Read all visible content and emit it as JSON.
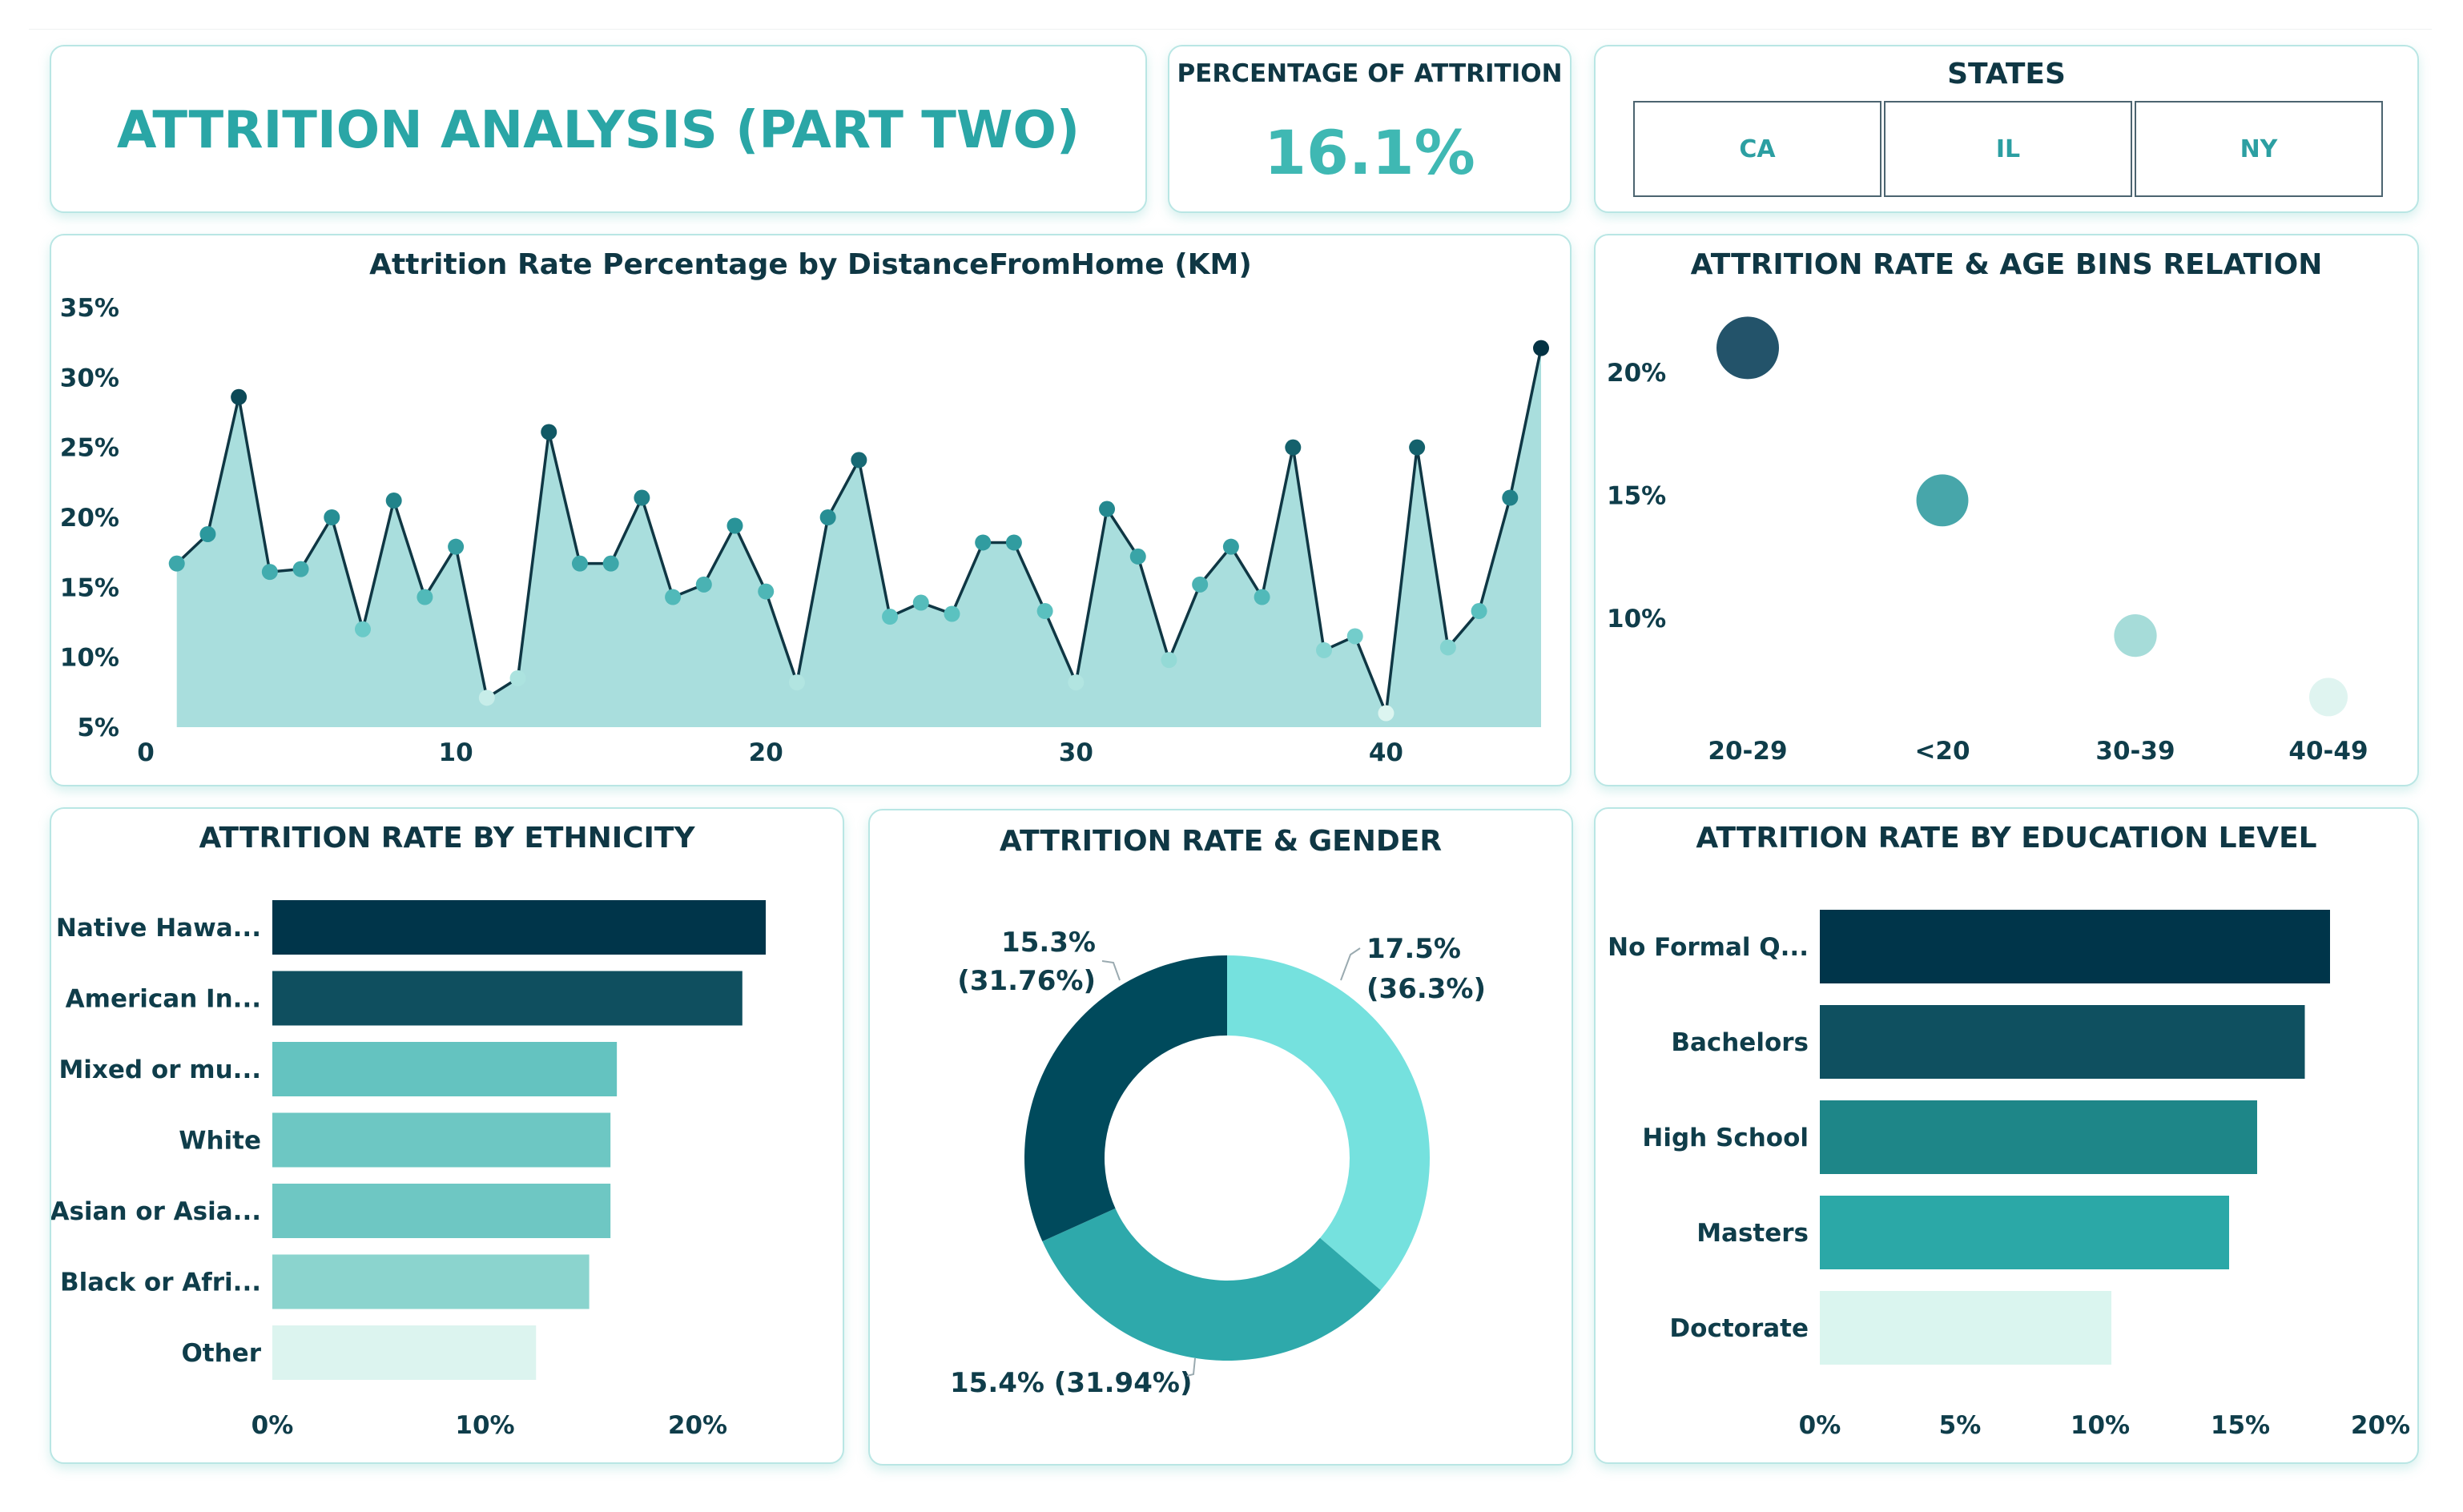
{
  "header": {
    "title": "ATTRITION ANALYSIS (PART TWO)"
  },
  "kpi": {
    "label": "PERCENTAGE OF ATTRITION",
    "value": "16.1%"
  },
  "states": {
    "label": "STATES",
    "options": [
      "CA",
      "IL",
      "NY"
    ]
  },
  "colors": {
    "accent": "#2aa6a6",
    "dark": "#003549",
    "card_border": "#b9e6e4"
  },
  "chart_data": [
    {
      "id": "distance",
      "type": "area",
      "title": "Attrition Rate Percentage by DistanceFromHome (KM)",
      "x": [
        1,
        2,
        3,
        4,
        5,
        6,
        7,
        8,
        9,
        10,
        11,
        12,
        13,
        14,
        15,
        16,
        17,
        18,
        19,
        20,
        21,
        22,
        23,
        24,
        25,
        26,
        27,
        28,
        29,
        30,
        31,
        32,
        33,
        34,
        35,
        36,
        37,
        38,
        39,
        40,
        41,
        42,
        43,
        44,
        45
      ],
      "values": [
        16.7,
        18.8,
        28.6,
        16.1,
        16.3,
        20.0,
        12.0,
        21.2,
        14.3,
        17.9,
        7.1,
        8.5,
        26.1,
        16.7,
        16.7,
        21.4,
        14.3,
        15.2,
        19.4,
        14.7,
        8.2,
        20.0,
        24.1,
        12.9,
        13.9,
        13.1,
        18.2,
        18.2,
        13.3,
        8.2,
        20.6,
        17.2,
        9.8,
        15.2,
        17.9,
        14.3,
        25.0,
        10.5,
        11.5,
        6.0,
        25.0,
        10.7,
        13.3,
        21.4,
        32.1
      ],
      "xlim": [
        0,
        45
      ],
      "xticks": [
        0,
        10,
        20,
        30,
        40
      ],
      "ylim": [
        5,
        35
      ],
      "yticks": [
        "5%",
        "10%",
        "15%",
        "20%",
        "25%",
        "30%",
        "35%"
      ],
      "ytick_values": [
        5,
        10,
        15,
        20,
        25,
        30,
        35
      ],
      "grid": false
    },
    {
      "id": "age",
      "type": "scatter",
      "title": "ATTRITION RATE & AGE BINS RELATION",
      "categories": [
        "20-29",
        "<20",
        "30-39",
        "40-49"
      ],
      "values": [
        21.0,
        14.8,
        9.3,
        6.8
      ],
      "ylim": [
        6,
        23
      ],
      "yticks": [
        "10%",
        "15%",
        "20%"
      ],
      "ytick_values": [
        10,
        15,
        20
      ],
      "colors": [
        "#23536a",
        "#47a6aa",
        "#a6dcd9",
        "#dff4f0"
      ]
    },
    {
      "id": "ethnicity",
      "type": "bar",
      "title": "ATTRITION RATE BY ETHNICITY",
      "categories": [
        "Native Hawa...",
        "American In...",
        "Mixed or mu...",
        "White",
        "Asian or Asia...",
        "Black or Afri...",
        "Other"
      ],
      "values": [
        23.2,
        22.1,
        16.2,
        15.9,
        15.9,
        14.9,
        12.4
      ],
      "xlim": [
        0,
        23.2
      ],
      "xticks": [
        "0%",
        "10%",
        "20%"
      ],
      "xtick_values": [
        0,
        10,
        20
      ],
      "colors": [
        "#00354a",
        "#0f4f5f",
        "#64c3c0",
        "#6dc7c3",
        "#6ec7c3",
        "#8bd4ce",
        "#dcf4ef"
      ]
    },
    {
      "id": "gender",
      "type": "pie",
      "title": "ATTRITION RATE & GENDER",
      "values": [
        17.5,
        15.4,
        15.3
      ],
      "labels": [
        "17.5%",
        "(36.3%)",
        "15.4% (31.94%)",
        "15.3%",
        "(31.76%)"
      ],
      "shares": [
        36.3,
        31.94,
        31.76
      ],
      "colors": [
        "#75e1de",
        "#2ea9ab",
        "#004a5c"
      ]
    },
    {
      "id": "education",
      "type": "bar",
      "title": "ATTRITION RATE BY EDUCATION LEVEL",
      "categories": [
        "No Formal Q...",
        "Bachelors",
        "High School",
        "Masters",
        "Doctorate"
      ],
      "values": [
        18.2,
        17.3,
        15.6,
        14.6,
        10.4
      ],
      "xlim": [
        0,
        20
      ],
      "xticks": [
        "0%",
        "5%",
        "10%",
        "15%",
        "20%"
      ],
      "xtick_values": [
        0,
        5,
        10,
        15,
        20
      ],
      "colors": [
        "#00354a",
        "#0f5060",
        "#1e8688",
        "#2ba8a7",
        "#daf5ef"
      ]
    }
  ]
}
